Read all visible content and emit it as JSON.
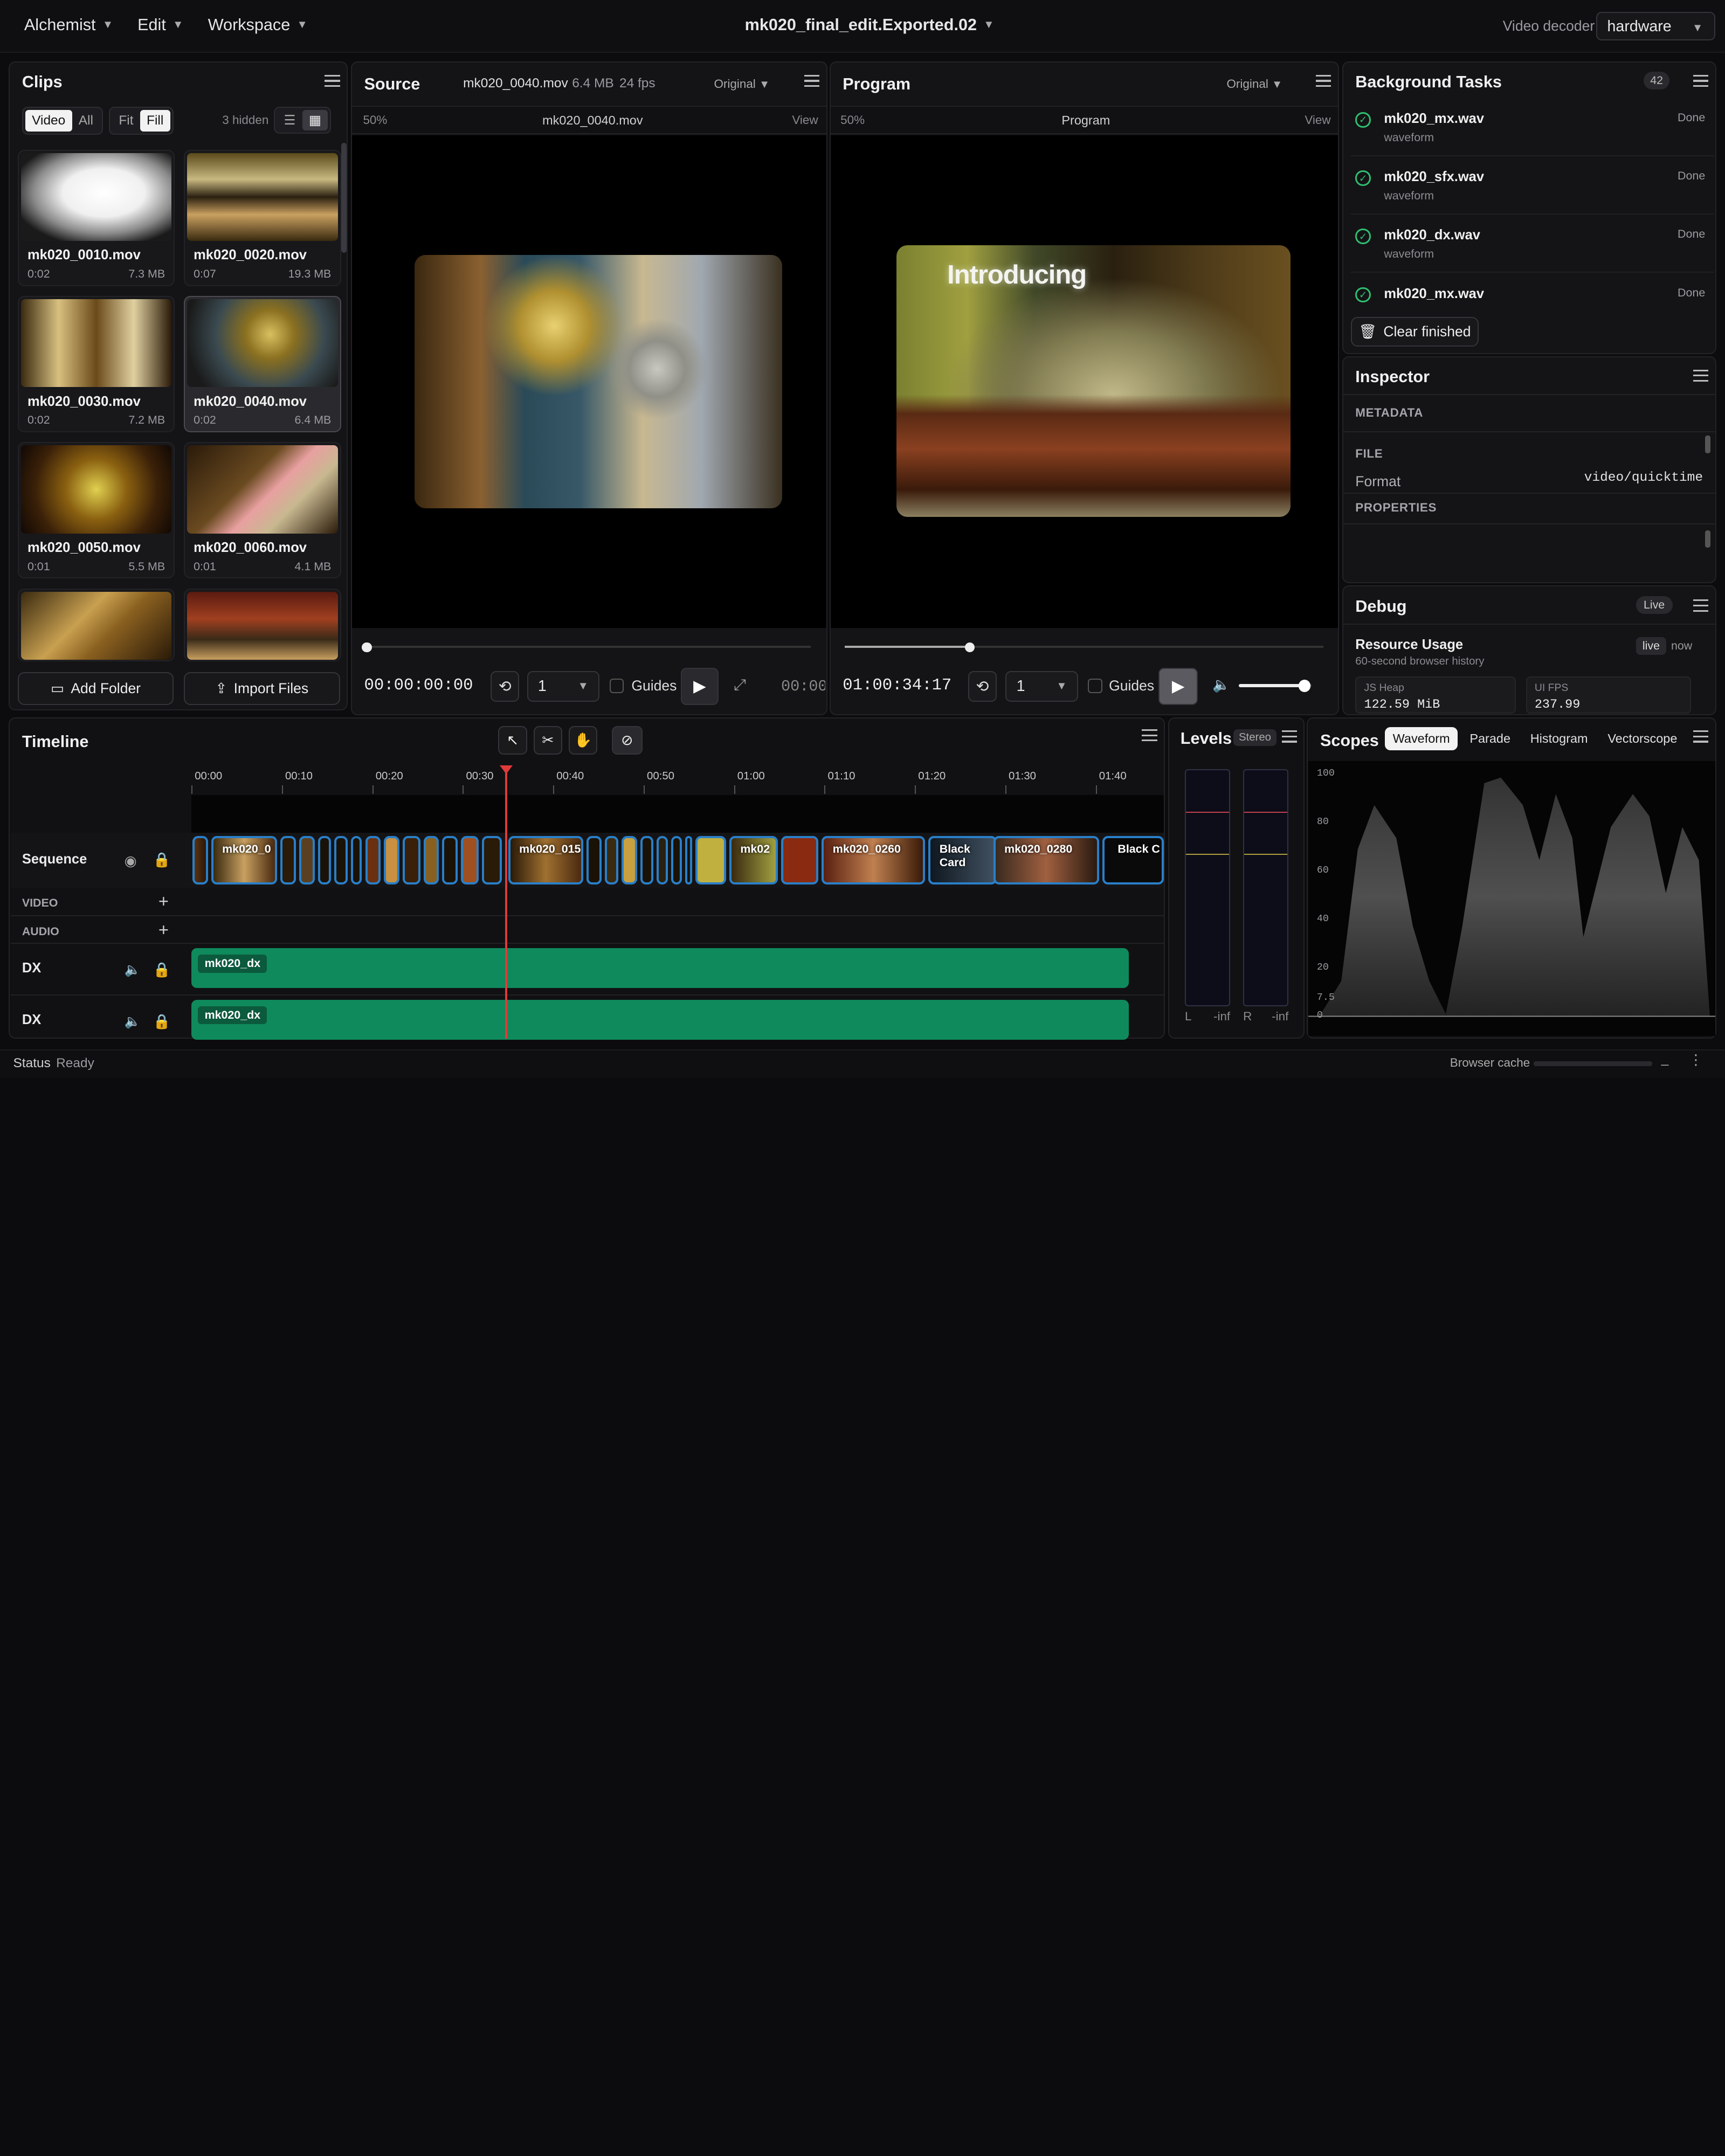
{
  "menubar": {
    "menus": [
      "Alchemist",
      "Edit",
      "Workspace"
    ],
    "title": "mk020_final_edit.Exported.02",
    "decoder_label": "Video decoder",
    "decoder_value": "hardware"
  },
  "clips": {
    "title": "Clips",
    "filter_a": [
      "Video",
      "All"
    ],
    "filter_b": [
      "Fit",
      "Fill"
    ],
    "hidden": "3 hidden",
    "items": [
      {
        "name": "mk020_0010.mov",
        "dur": "0:02",
        "size": "7.3 MB"
      },
      {
        "name": "mk020_0020.mov",
        "dur": "0:07",
        "size": "19.3 MB"
      },
      {
        "name": "mk020_0030.mov",
        "dur": "0:02",
        "size": "7.2 MB"
      },
      {
        "name": "mk020_0040.mov",
        "dur": "0:02",
        "size": "6.4 MB"
      },
      {
        "name": "mk020_0050.mov",
        "dur": "0:01",
        "size": "5.5 MB"
      },
      {
        "name": "mk020_0060.mov",
        "dur": "0:01",
        "size": "4.1 MB"
      }
    ],
    "add_folder": "Add Folder",
    "import_files": "Import Files"
  },
  "source": {
    "title": "Source",
    "file": "mk020_0040.mov",
    "size": "6.4 MB",
    "fps": "24 fps",
    "mode": "Original",
    "zoom": "50%",
    "subtitle": "mk020_0040.mov",
    "view": "View",
    "timecode": "00:00:00:00",
    "speed": "1",
    "guides": "Guides",
    "timecode_right": "00:00:",
    "progress": 0
  },
  "program": {
    "title": "Program",
    "mode": "Original",
    "zoom": "50%",
    "subtitle": "Program",
    "view": "View",
    "overlay": "Introducing",
    "timecode": "01:00:34:17",
    "speed": "1",
    "guides": "Guides",
    "progress": 0.26,
    "volume": 0.9
  },
  "tasks": {
    "title": "Background Tasks",
    "count": "42",
    "items": [
      {
        "name": "mk020_mx.wav",
        "sub": "waveform",
        "status": "Done"
      },
      {
        "name": "mk020_sfx.wav",
        "sub": "waveform",
        "status": "Done"
      },
      {
        "name": "mk020_dx.wav",
        "sub": "waveform",
        "status": "Done"
      },
      {
        "name": "mk020_mx.wav",
        "sub": "",
        "status": "Done"
      }
    ],
    "clear": "Clear finished"
  },
  "inspector": {
    "title": "Inspector",
    "metadata": "METADATA",
    "file": "FILE",
    "format_label": "Format",
    "format_value": "video/quicktime",
    "properties": "PROPERTIES"
  },
  "debug": {
    "title": "Debug",
    "live_badge": "Live",
    "resource": "Resource Usage",
    "resource_sub": "60-second browser history",
    "live": "live",
    "now": "now",
    "heap_label": "JS Heap",
    "heap_value": "122.59 MiB",
    "fps_label": "UI FPS",
    "fps_value": "237.99"
  },
  "timeline": {
    "title": "Timeline",
    "ticks": [
      "00:00",
      "00:10",
      "00:20",
      "00:30",
      "00:40",
      "00:50",
      "01:00",
      "01:10",
      "01:20",
      "01:30",
      "01:40"
    ],
    "sequence": "Sequence",
    "video": "VIDEO",
    "audio": "AUDIO",
    "clip_labels": [
      "mk020_0",
      "mk020_015",
      "mk02",
      "mk020_0260",
      "Black Card",
      "mk020_0280",
      "Black C"
    ],
    "tracks": [
      {
        "name": "DX",
        "clip": "mk020_dx"
      },
      {
        "name": "DX",
        "clip": "mk020_dx"
      }
    ]
  },
  "levels": {
    "title": "Levels",
    "mode": "Stereo",
    "l": "L",
    "r": "R",
    "l_val": "-inf",
    "r_val": "-inf"
  },
  "scopes": {
    "title": "Scopes",
    "tabs": [
      "Waveform",
      "Parade",
      "Histogram",
      "Vectorscope"
    ],
    "scale": [
      "100",
      "80",
      "60",
      "40",
      "20",
      "7.5",
      "0"
    ]
  },
  "status": {
    "label": "Status",
    "value": "Ready",
    "cache": "Browser cache"
  }
}
